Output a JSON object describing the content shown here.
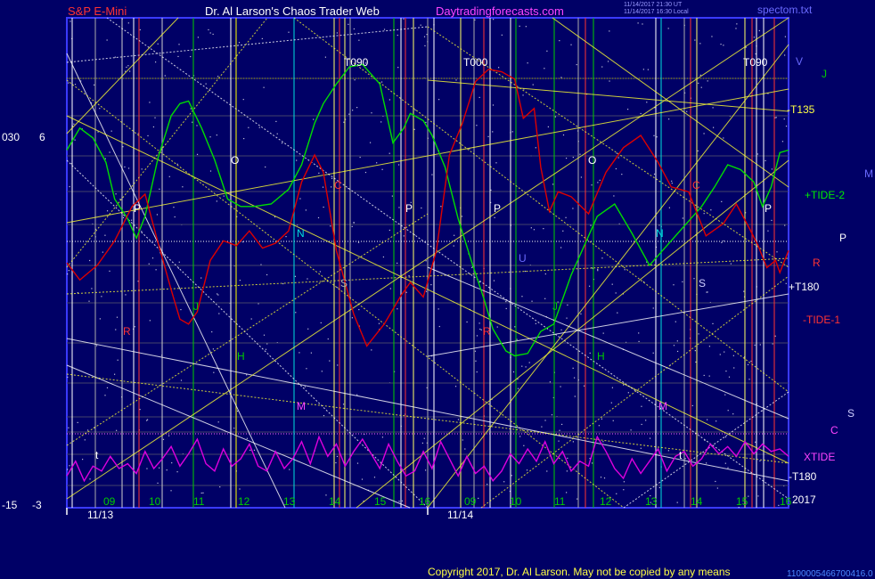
{
  "header": {
    "symbol": "S&P E-Mini",
    "author": "Dr. Al Larson's Chaos Trader Web",
    "site": "Daytradingforecasts.com",
    "stamp_1": "11/14/2017 21:30 UT",
    "stamp_2": "11/14/2017 16:30 Local",
    "file": "spectom.txt",
    "footer": "Copyright 2017, Dr. Al Larson. May not be copied by any means",
    "footer_code": "1100005466700416.0"
  },
  "left_axis": {
    "label_030": "030",
    "label_6": "6",
    "label_m15": "-15",
    "label_m3": "-3"
  },
  "right_labels": {
    "v": "V",
    "j": "J",
    "t135": "-T135",
    "m": "M",
    "tide2": "+TIDE-2",
    "p": "P",
    "r": "R",
    "t180p": "+T180",
    "tide1": "-TIDE-1",
    "s": "S",
    "c": "C",
    "xtide": "XTIDE",
    "t180m": "-T180",
    "year": "2017"
  },
  "time_labels": {
    "h09a": "09",
    "h10a": "10",
    "h11a": "11",
    "h12a": "12",
    "h13a": "13",
    "h14a": "14",
    "h15a": "15",
    "h16a": "16",
    "h09b": "09",
    "h10b": "10",
    "h11b": "11",
    "h12b": "12",
    "h13b": "13",
    "h14b": "14",
    "h15b": "15",
    "h16b": "16",
    "d1": "11/13",
    "d2": "11/14"
  },
  "markers": {
    "t090a": "T090",
    "t000": "T000",
    "t090b": "T090",
    "o1": "O",
    "o2": "O",
    "p1": "P",
    "p2": "P",
    "p3": "P",
    "p4": "P",
    "n1": "N",
    "n2": "N",
    "s1": "S",
    "s2": "S",
    "m1": "M",
    "m2": "M",
    "h1": "H",
    "h2": "H",
    "j1": "J",
    "j2": "J",
    "c1": "C",
    "c2": "C",
    "r1": "R",
    "r2": "R",
    "u1": "U",
    "t1": "t",
    "t2": "t"
  },
  "colors": {
    "background": "#000066",
    "plot_border": "#3a3aff",
    "tide2": "#00dd00",
    "tide1": "#dd0000",
    "xtide": "#dd00dd",
    "grid": "#ffff00",
    "text": "#ffffff"
  },
  "chart_data": {
    "type": "line",
    "x_unit": "hour",
    "x_days": [
      "11/13",
      "11/14"
    ],
    "series": [
      {
        "name": "+TIDE-2",
        "color": "#00dd00",
        "x": [
          8.2,
          8.5,
          8.8,
          9.1,
          9.3,
          9.6,
          9.8,
          10.0,
          10.3,
          10.6,
          10.8,
          11.0,
          11.3,
          11.6,
          11.9,
          12.2,
          12.5,
          12.9,
          13.3,
          13.6,
          13.9,
          14.1,
          14.4,
          14.7,
          15.0,
          15.4,
          15.7,
          15.95,
          16.1,
          16.4,
          16.6,
          16.9,
          17.2,
          17.5,
          17.8,
          18.0,
          18.3,
          18.5,
          18.8,
          19.1,
          19.4,
          19.8,
          20.1,
          20.4,
          20.8,
          21.2,
          21.6,
          22.0,
          22.4,
          22.8,
          23.1,
          23.4,
          23.7,
          24.0,
          24.2,
          24.4,
          24.6,
          24.8
        ],
        "y": [
          2.1,
          3.0,
          2.6,
          1.6,
          0.1,
          -0.7,
          -1.5,
          -0.6,
          1.8,
          3.5,
          4.0,
          4.1,
          3.0,
          1.7,
          0.1,
          -0.2,
          -0.2,
          -0.1,
          0.5,
          1.5,
          3.2,
          4.0,
          4.8,
          5.5,
          5.6,
          4.8,
          2.4,
          3.0,
          3.6,
          3.3,
          2.7,
          1.4,
          -0.7,
          -2.4,
          -4.0,
          -5.2,
          -6.1,
          -6.3,
          -6.2,
          -5.3,
          -5.0,
          -3.0,
          -1.8,
          -0.6,
          -0.1,
          -1.3,
          -2.6,
          -1.8,
          -1.0,
          -0.2,
          0.6,
          1.5,
          1.3,
          0.8,
          -0.2,
          0.6,
          2.0,
          2.1
        ]
      },
      {
        "name": "-TIDE-1",
        "color": "#dd0000",
        "x": [
          8.2,
          8.5,
          8.9,
          9.3,
          9.7,
          10.0,
          10.3,
          10.6,
          10.8,
          11.0,
          11.2,
          11.5,
          11.8,
          12.1,
          12.4,
          12.7,
          13.0,
          13.3,
          13.6,
          13.9,
          14.1,
          14.4,
          14.8,
          15.1,
          15.5,
          15.9,
          16.1,
          16.4,
          16.7,
          17.0,
          17.3,
          17.6,
          17.9,
          18.2,
          18.5,
          18.7,
          18.95,
          19.1,
          19.3,
          19.5,
          19.8,
          20.2,
          20.6,
          21.0,
          21.4,
          21.8,
          22.1,
          22.5,
          22.9,
          23.3,
          23.6,
          23.9,
          24.1,
          24.3,
          24.5,
          24.6,
          24.8
        ],
        "y": [
          -2.5,
          -3.2,
          -2.6,
          -1.6,
          -0.2,
          0.3,
          -1.7,
          -3.6,
          -4.8,
          -5.0,
          -4.5,
          -2.4,
          -1.6,
          -1.8,
          -1.2,
          -1.9,
          -1.7,
          -1.2,
          0.8,
          1.9,
          1.2,
          -2.0,
          -4.6,
          -5.9,
          -5.0,
          -3.8,
          -3.3,
          -3.9,
          -2.0,
          1.9,
          3.2,
          4.9,
          5.4,
          5.3,
          5.0,
          3.4,
          3.8,
          1.4,
          -0.4,
          0.4,
          0.2,
          -0.5,
          1.2,
          2.2,
          2.7,
          1.6,
          0.6,
          0.4,
          -1.4,
          -0.9,
          -0.1,
          -1.1,
          -1.8,
          -2.7,
          -2.4,
          -2.9,
          -2.0
        ]
      },
      {
        "name": "XTIDE",
        "color": "#dd00dd",
        "x": [
          8.2,
          8.4,
          8.6,
          8.8,
          9.0,
          9.2,
          9.4,
          9.6,
          9.8,
          10.0,
          10.2,
          10.4,
          10.6,
          10.8,
          11.0,
          11.2,
          11.4,
          11.6,
          11.8,
          12.0,
          12.2,
          12.4,
          12.6,
          12.8,
          13.0,
          13.2,
          13.4,
          13.6,
          13.8,
          14.0,
          14.2,
          14.4,
          14.6,
          14.8,
          15.0,
          15.2,
          15.4,
          15.6,
          15.8,
          16.0,
          16.2,
          16.4,
          16.6,
          16.8,
          17.0,
          17.2,
          17.4,
          17.6,
          17.8,
          18.0,
          18.2,
          18.4,
          18.6,
          18.8,
          19.0,
          19.2,
          19.4,
          19.6,
          19.8,
          20.0,
          20.2,
          20.4,
          20.6,
          20.8,
          21.0,
          21.2,
          21.4,
          21.6,
          21.8,
          22.0,
          22.2,
          22.4,
          22.6,
          22.8,
          23.0,
          23.2,
          23.4,
          23.6,
          23.8,
          24.0,
          24.2,
          24.4,
          24.6,
          24.8
        ],
        "y": [
          -11.2,
          -10.6,
          -11.4,
          -10.8,
          -11.0,
          -10.4,
          -10.9,
          -10.7,
          -11.1,
          -10.2,
          -10.9,
          -10.5,
          -10.0,
          -10.8,
          -10.3,
          -9.7,
          -10.7,
          -11.0,
          -10.1,
          -10.8,
          -10.5,
          -9.9,
          -10.8,
          -11.0,
          -10.2,
          -10.9,
          -10.5,
          -9.8,
          -10.7,
          -9.6,
          -10.4,
          -9.9,
          -10.8,
          -10.2,
          -9.7,
          -10.3,
          -10.9,
          -9.9,
          -10.6,
          -11.2,
          -11.0,
          -10.2,
          -10.9,
          -9.8,
          -10.5,
          -11.2,
          -10.4,
          -11.1,
          -10.8,
          -11.4,
          -11.0,
          -10.3,
          -10.7,
          -10.1,
          -10.6,
          -9.8,
          -10.7,
          -10.2,
          -11.0,
          -10.6,
          -10.8,
          -9.6,
          -10.2,
          -10.9,
          -11.3,
          -10.5,
          -11.1,
          -10.6,
          -10.1,
          -11.0,
          -10.4,
          -10.2,
          -10.8,
          -10.5,
          -9.9,
          -10.3,
          -10.0,
          -10.4,
          -9.8,
          -10.3,
          -9.9,
          -10.2,
          -10.1,
          -10.4
        ]
      }
    ]
  }
}
